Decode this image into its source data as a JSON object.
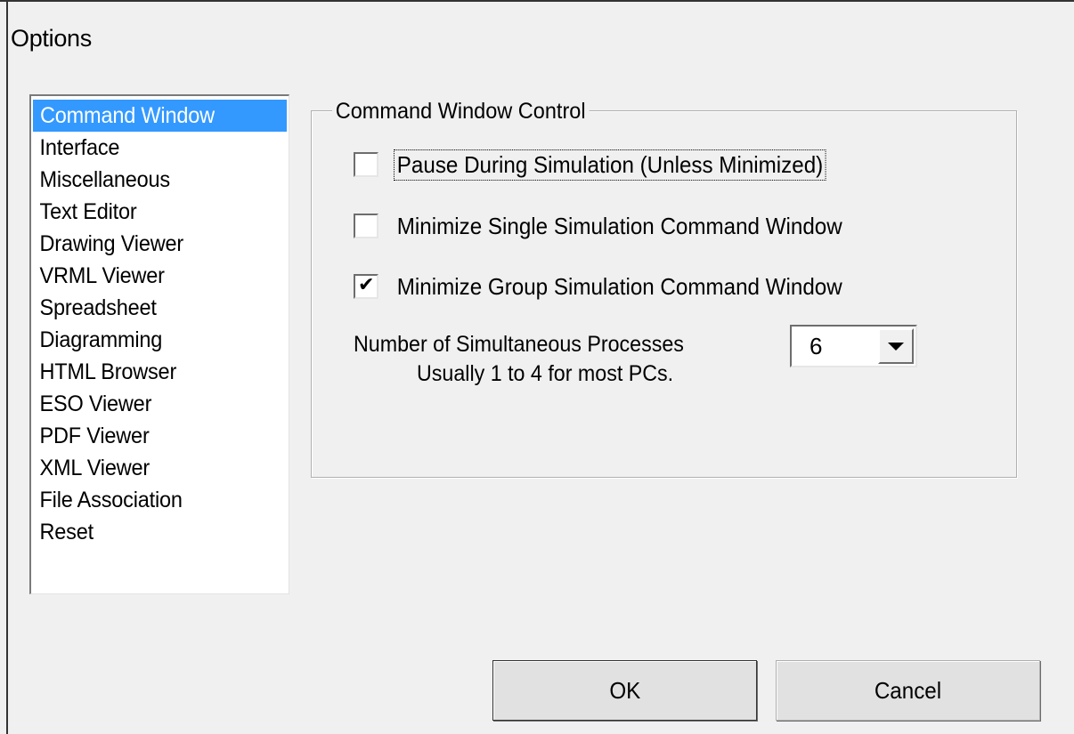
{
  "window": {
    "title": "Options"
  },
  "sidebar": {
    "items": [
      {
        "label": "Command Window",
        "selected": true
      },
      {
        "label": "Interface",
        "selected": false
      },
      {
        "label": "Miscellaneous",
        "selected": false
      },
      {
        "label": "Text Editor",
        "selected": false
      },
      {
        "label": "Drawing Viewer",
        "selected": false
      },
      {
        "label": "VRML Viewer",
        "selected": false
      },
      {
        "label": "Spreadsheet",
        "selected": false
      },
      {
        "label": "Diagramming",
        "selected": false
      },
      {
        "label": "HTML Browser",
        "selected": false
      },
      {
        "label": "ESO Viewer",
        "selected": false
      },
      {
        "label": "PDF Viewer",
        "selected": false
      },
      {
        "label": "XML Viewer",
        "selected": false
      },
      {
        "label": "File Association",
        "selected": false
      },
      {
        "label": "Reset",
        "selected": false
      }
    ]
  },
  "group": {
    "title": "Command Window Control",
    "options": [
      {
        "label": "Pause During Simulation (Unless Minimized)",
        "checked": false,
        "focused": true
      },
      {
        "label": "Minimize Single Simulation Command Window",
        "checked": false,
        "focused": false
      },
      {
        "label": "Minimize Group Simulation Command Window",
        "checked": true,
        "focused": false
      }
    ],
    "processes_label": "Number of Simultaneous Processes",
    "processes_hint": "Usually 1 to 4 for most PCs.",
    "processes_value": "6"
  },
  "buttons": {
    "ok": "OK",
    "cancel": "Cancel"
  },
  "colors": {
    "selection": "#3399ff",
    "background": "#f0f0f0"
  }
}
